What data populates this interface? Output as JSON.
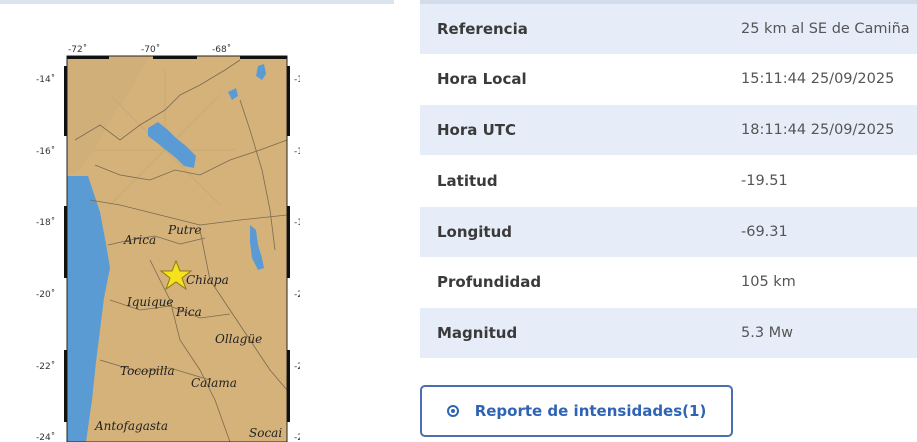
{
  "map": {
    "lon_ticks": [
      "-72˚",
      "-70˚",
      "-68˚"
    ],
    "lat_ticks": [
      "-14˚",
      "-16˚",
      "-18˚",
      "-20˚",
      "-22˚",
      "-24˚"
    ],
    "places": {
      "putre": "Putre",
      "arica": "Arica",
      "chiapa": "Chiapa",
      "iquique": "Iquique",
      "pica": "Pica",
      "ollague": "Ollagüe",
      "tocopilla": "Tocopilla",
      "calama": "Calama",
      "antofagasta": "Antofagasta",
      "socaire": "Socai"
    },
    "colors": {
      "land": "#d4b27a",
      "sea": "#5a9bd3",
      "lake": "#5b9bd5",
      "epicenter": "#f5e11c"
    }
  },
  "details": {
    "rows": [
      {
        "label": "Referencia",
        "value": "25 km al SE de Camiña"
      },
      {
        "label": "Hora Local",
        "value": "15:11:44 25/09/2025"
      },
      {
        "label": "Hora UTC",
        "value": "18:11:44 25/09/2025"
      },
      {
        "label": "Latitud",
        "value": "-19.51"
      },
      {
        "label": "Longitud",
        "value": "-69.31"
      },
      {
        "label": "Profundidad",
        "value": "105 km"
      },
      {
        "label": "Magnitud",
        "value": "5.3 Mw"
      }
    ]
  },
  "report_button": {
    "label": "Reporte de intensidades(1)",
    "icon": "radio-dot-icon"
  }
}
